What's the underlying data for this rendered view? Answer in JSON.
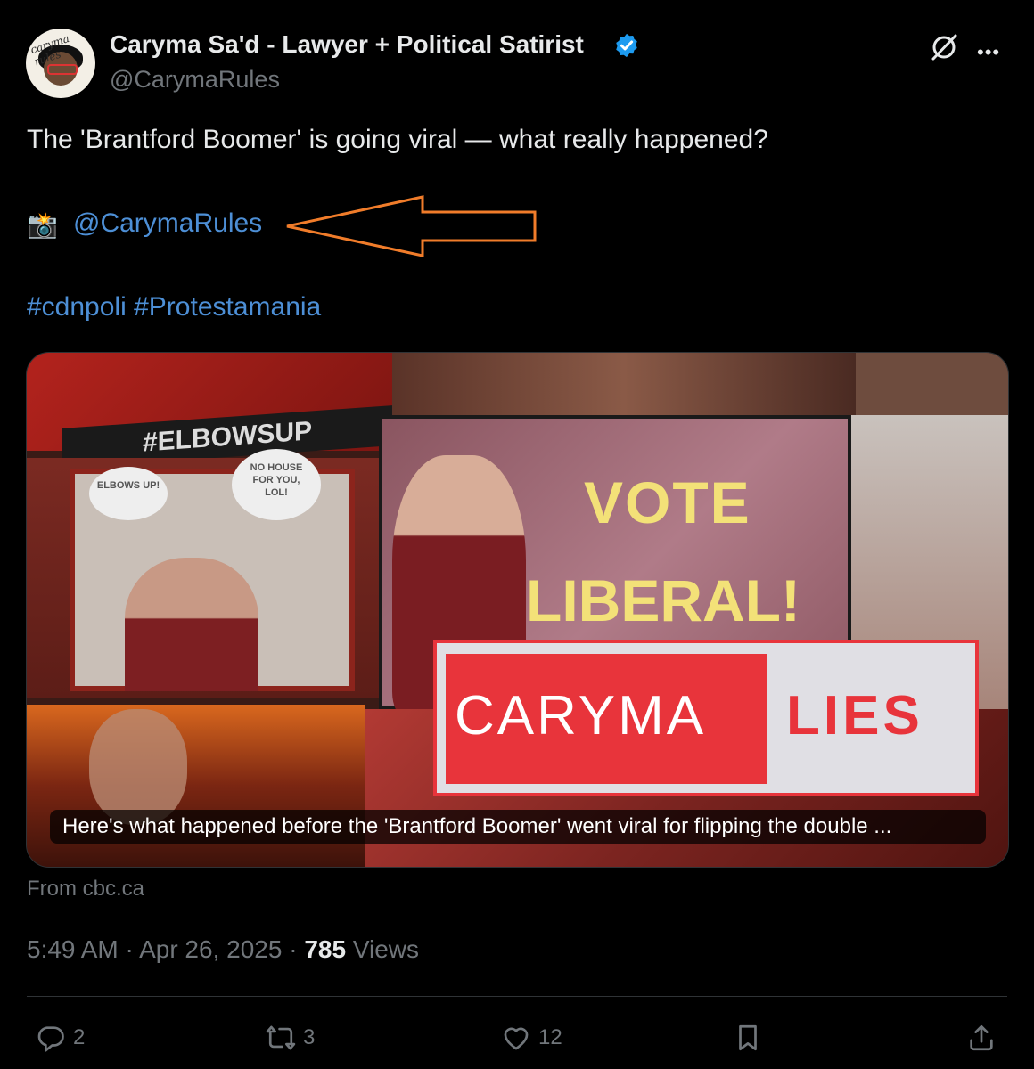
{
  "author": {
    "name": "Caryma Sa'd - Lawyer + Political Satirist",
    "handle": "@CarymaRules",
    "avatar_text": "caryma rules",
    "verified_color": "#1d9bf0"
  },
  "tweet": {
    "text": "The 'Brantford Boomer' is going viral — what really happened?",
    "camera_emoji": "📸",
    "mention": "@CarymaRules",
    "hashtags": [
      "#cdnpoli",
      "#Protestamania"
    ],
    "link_color": "#4d8fd6",
    "annotation_arrow_color": "#f07c2a"
  },
  "card": {
    "image_text": {
      "vote": "VOTE",
      "liberal": "LIBERAL!",
      "logo_left": "CARYMA",
      "logo_right": "LIES",
      "banner": "#ELBOWSUP",
      "bubble1": "ELBOWS UP!",
      "bubble2": "NO HOUSE FOR YOU, LOL!"
    },
    "caption": "Here's what happened before the 'Brantford Boomer' went viral for flipping the double ...",
    "source": "From cbc.ca"
  },
  "meta": {
    "time": "5:49 AM",
    "separator": "·",
    "date": "Apr 26, 2025",
    "views_count": "785",
    "views_label": "Views"
  },
  "actions": {
    "replies": "2",
    "reposts": "3",
    "likes": "12"
  }
}
